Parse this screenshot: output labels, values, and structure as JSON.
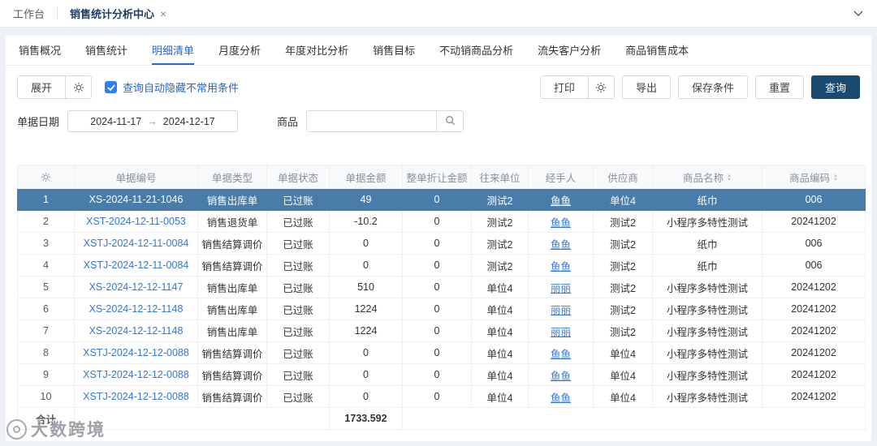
{
  "window": {
    "tabs": [
      {
        "label": "工作台",
        "active": false
      },
      {
        "label": "销售统计分析中心",
        "active": true,
        "close": "×"
      }
    ]
  },
  "nav_tabs": [
    {
      "label": "销售概况"
    },
    {
      "label": "销售统计"
    },
    {
      "label": "明细清单"
    },
    {
      "label": "月度分析"
    },
    {
      "label": "年度对比分析"
    },
    {
      "label": "销售目标"
    },
    {
      "label": "不动销商品分析"
    },
    {
      "label": "流失客户分析"
    },
    {
      "label": "商品销售成本"
    }
  ],
  "active_nav_tab": "明细清单",
  "toolbar": {
    "expand": "展开",
    "auto_hide_label": "查询自动隐藏不常用条件",
    "auto_hide_checked": true,
    "print": "打印",
    "export": "导出",
    "save_conditions": "保存条件",
    "reset": "重置",
    "query": "查询"
  },
  "filters": {
    "date_label": "单据日期",
    "date_start": "2024-11-17",
    "date_arrow": "→",
    "date_end": "2024-12-17",
    "product_label": "商品",
    "product_value": ""
  },
  "colors": {
    "accent_blue": "#2a66c8",
    "primary_button": "#1a4a70",
    "selected_row": "#4a7ca9",
    "link": "#3577d4"
  },
  "table": {
    "headers": [
      "",
      "单据编号",
      "单据类型",
      "单据状态",
      "单据金额",
      "整单折让金额",
      "往来单位",
      "经手人",
      "供应商",
      "商品名称",
      "商品编码"
    ],
    "rows": [
      {
        "selected": true,
        "cells": [
          "1",
          "XS-2024-11-21-1046",
          "销售出库单",
          "已过账",
          "49",
          "0",
          "测试2",
          "鱼鱼",
          "单位4",
          "纸巾",
          "006"
        ]
      },
      {
        "selected": false,
        "cells": [
          "2",
          "XST-2024-12-11-0053",
          "销售退货单",
          "已过账",
          "-10.2",
          "0",
          "测试2",
          "鱼鱼",
          "测试2",
          "小程序多特性测试",
          "20241202"
        ]
      },
      {
        "selected": false,
        "cells": [
          "3",
          "XSTJ-2024-12-11-0084",
          "销售结算调价",
          "已过账",
          "0",
          "0",
          "测试2",
          "鱼鱼",
          "测试2",
          "纸巾",
          "006"
        ]
      },
      {
        "selected": false,
        "cells": [
          "4",
          "XSTJ-2024-12-11-0084",
          "销售结算调价",
          "已过账",
          "0",
          "0",
          "测试2",
          "鱼鱼",
          "测试2",
          "纸巾",
          "006"
        ]
      },
      {
        "selected": false,
        "cells": [
          "5",
          "XS-2024-12-12-1147",
          "销售出库单",
          "已过账",
          "510",
          "0",
          "单位4",
          "丽丽",
          "测试2",
          "小程序多特性测试",
          "20241202"
        ]
      },
      {
        "selected": false,
        "cells": [
          "6",
          "XS-2024-12-12-1148",
          "销售出库单",
          "已过账",
          "1224",
          "0",
          "单位4",
          "丽丽",
          "测试2",
          "小程序多特性测试",
          "20241202"
        ]
      },
      {
        "selected": false,
        "cells": [
          "7",
          "XS-2024-12-12-1148",
          "销售出库单",
          "已过账",
          "1224",
          "0",
          "单位4",
          "丽丽",
          "测试2",
          "小程序多特性测试",
          "20241202"
        ]
      },
      {
        "selected": false,
        "cells": [
          "8",
          "XSTJ-2024-12-12-0088",
          "销售结算调价",
          "已过账",
          "0",
          "0",
          "单位4",
          "鱼鱼",
          "单位4",
          "小程序多特性测试",
          "20241202"
        ]
      },
      {
        "selected": false,
        "cells": [
          "9",
          "XSTJ-2024-12-12-0088",
          "销售结算调价",
          "已过账",
          "0",
          "0",
          "单位4",
          "鱼鱼",
          "单位4",
          "小程序多特性测试",
          "20241202"
        ]
      },
      {
        "selected": false,
        "cells": [
          "10",
          "XSTJ-2024-12-12-0088",
          "销售结算调价",
          "已过账",
          "0",
          "0",
          "单位4",
          "鱼鱼",
          "单位4",
          "小程序多特性测试",
          "20241202"
        ]
      }
    ],
    "footer": {
      "label": "合计",
      "total": "1733.592"
    }
  },
  "watermark": {
    "text": "大数跨境"
  }
}
